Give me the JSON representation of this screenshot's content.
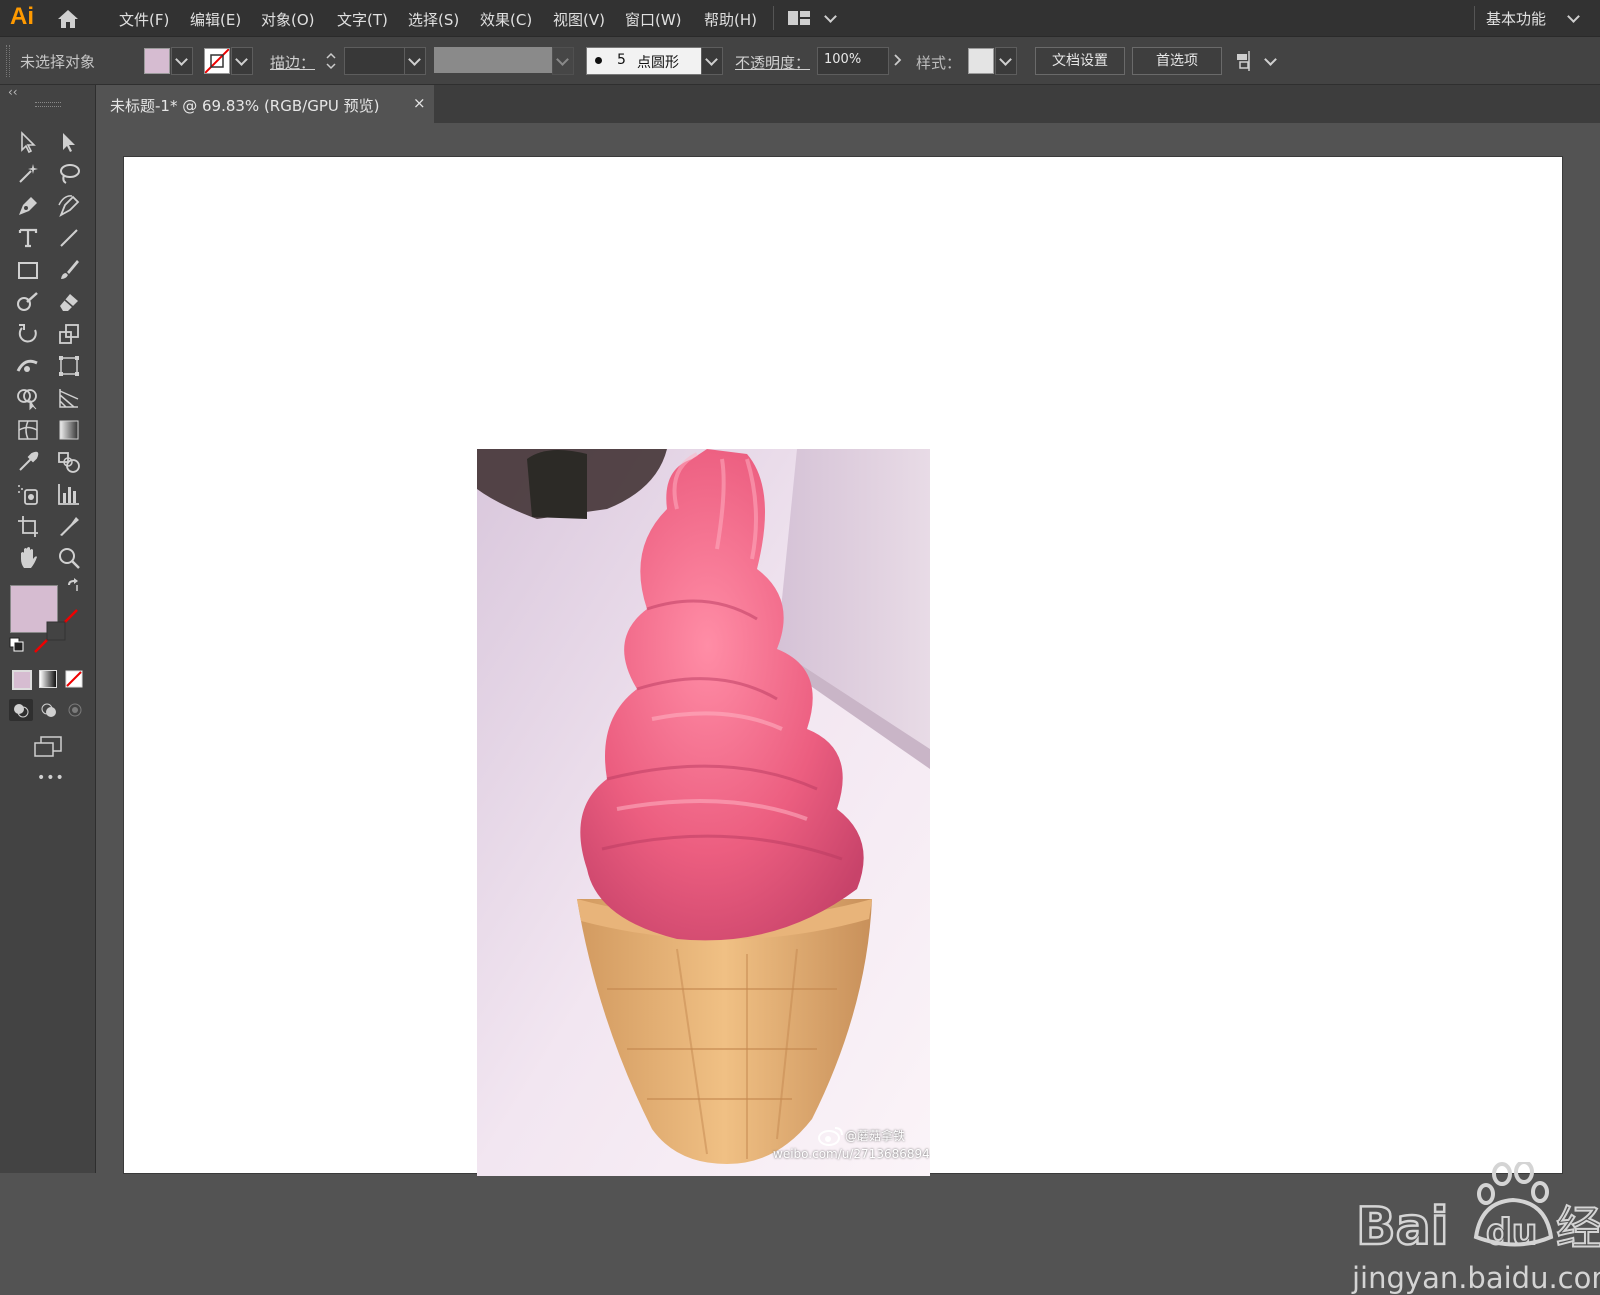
{
  "app": {
    "logo": "Ai",
    "workspace": "基本功能"
  },
  "menu": [
    "文件(F)",
    "编辑(E)",
    "对象(O)",
    "文字(T)",
    "选择(S)",
    "效果(C)",
    "视图(V)",
    "窗口(W)",
    "帮助(H)"
  ],
  "control_bar": {
    "selection_status": "未选择对象",
    "stroke_label": "描边：",
    "brush_size": "5",
    "brush_type": "点圆形",
    "opacity_label": "不透明度：",
    "opacity_value": "100%",
    "style_label": "样式：",
    "doc_setup_button": "文档设置",
    "preferences_button": "首选项"
  },
  "document_tab": {
    "title": "未标题-1* @ 69.83% (RGB/GPU 预览)",
    "close": "×"
  },
  "toolbar": {
    "collapse": "‹‹",
    "more": "•••"
  },
  "colors": {
    "fill": "#d6bcd1",
    "accent": "#ff9a00"
  },
  "image": {
    "caption_handle": "@蘑菇拿铁",
    "caption_url": "weibo.com/u/2713686894"
  },
  "watermark": {
    "brand": "Bai",
    "brand_suffix": "du",
    "chinese": "经验",
    "url": "jingyan.baidu.com"
  }
}
